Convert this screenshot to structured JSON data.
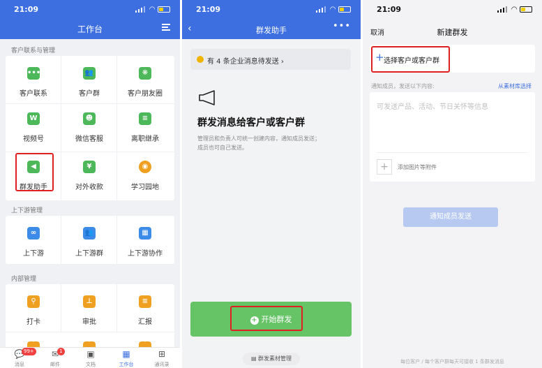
{
  "colors": {
    "brand_blue": "#3d6fe0",
    "highlight_red": "#e02020",
    "green": "#67c466"
  },
  "panel1": {
    "status_time": "21:09",
    "title": "工作台",
    "sections": [
      {
        "title": "客户联系与管理",
        "items": [
          {
            "label": "客户联系",
            "icon": "chat-bubble-icon",
            "color": "#4cb85a"
          },
          {
            "label": "客户群",
            "icon": "group-icon",
            "color": "#4cb85a"
          },
          {
            "label": "客户朋友圈",
            "icon": "aperture-icon",
            "color": "#4cb85a"
          },
          {
            "label": "视频号",
            "icon": "video-channel-icon",
            "color": "#4cb85a"
          },
          {
            "label": "微信客服",
            "icon": "service-icon",
            "color": "#4cb85a"
          },
          {
            "label": "离职继承",
            "icon": "document-icon",
            "color": "#4cb85a"
          },
          {
            "label": "群发助手",
            "icon": "megaphone-icon",
            "color": "#4cb85a"
          },
          {
            "label": "对外收款",
            "icon": "payment-icon",
            "color": "#4cb85a"
          },
          {
            "label": "学习园地",
            "icon": "planet-icon",
            "color": "#f0a020"
          }
        ]
      },
      {
        "title": "上下游管理",
        "items": [
          {
            "label": "上下游",
            "icon": "link-icon",
            "color": "#3d8be8"
          },
          {
            "label": "上下游群",
            "icon": "group-icon",
            "color": "#3d8be8"
          },
          {
            "label": "上下游协作",
            "icon": "grid-icon",
            "color": "#3d8be8"
          }
        ]
      },
      {
        "title": "内部管理",
        "items": [
          {
            "label": "打卡",
            "icon": "location-icon",
            "color": "#f0a020"
          },
          {
            "label": "审批",
            "icon": "stamp-icon",
            "color": "#f0a020"
          },
          {
            "label": "汇报",
            "icon": "report-icon",
            "color": "#f0a020"
          }
        ]
      }
    ],
    "tabs": [
      {
        "label": "消息",
        "icon": "message-icon",
        "badge": "99+"
      },
      {
        "label": "邮件",
        "icon": "mail-icon",
        "badge": "1"
      },
      {
        "label": "文档",
        "icon": "doc-icon",
        "badge": ""
      },
      {
        "label": "工作台",
        "icon": "workbench-icon",
        "badge": ""
      },
      {
        "label": "通讯录",
        "icon": "contacts-icon",
        "badge": ""
      }
    ]
  },
  "panel2": {
    "status_time": "21:09",
    "title": "群发助手",
    "notice": "有 4 条企业消息待发送",
    "heading": "群发消息给客户或客户群",
    "desc_line1": "管理员和负责人可统一创建内容，通知成员发送；",
    "desc_line2": "成员也可自己发送。",
    "start_button": "开始群发",
    "material_button": "群发素材管理"
  },
  "panel3": {
    "status_time": "21:09",
    "cancel": "取消",
    "title": "新建群发",
    "choose": "选择客户或客户群",
    "notify_label": "通知成员，发送以下内容:",
    "library_link": "从素材库选择",
    "placeholder": "可发送产品、活动、节日关怀等信息",
    "attach": "添加图片等附件",
    "send_button": "通知成员发送",
    "footer": "每位客户 / 每个客户群每天可接收 1 条群发消息"
  }
}
